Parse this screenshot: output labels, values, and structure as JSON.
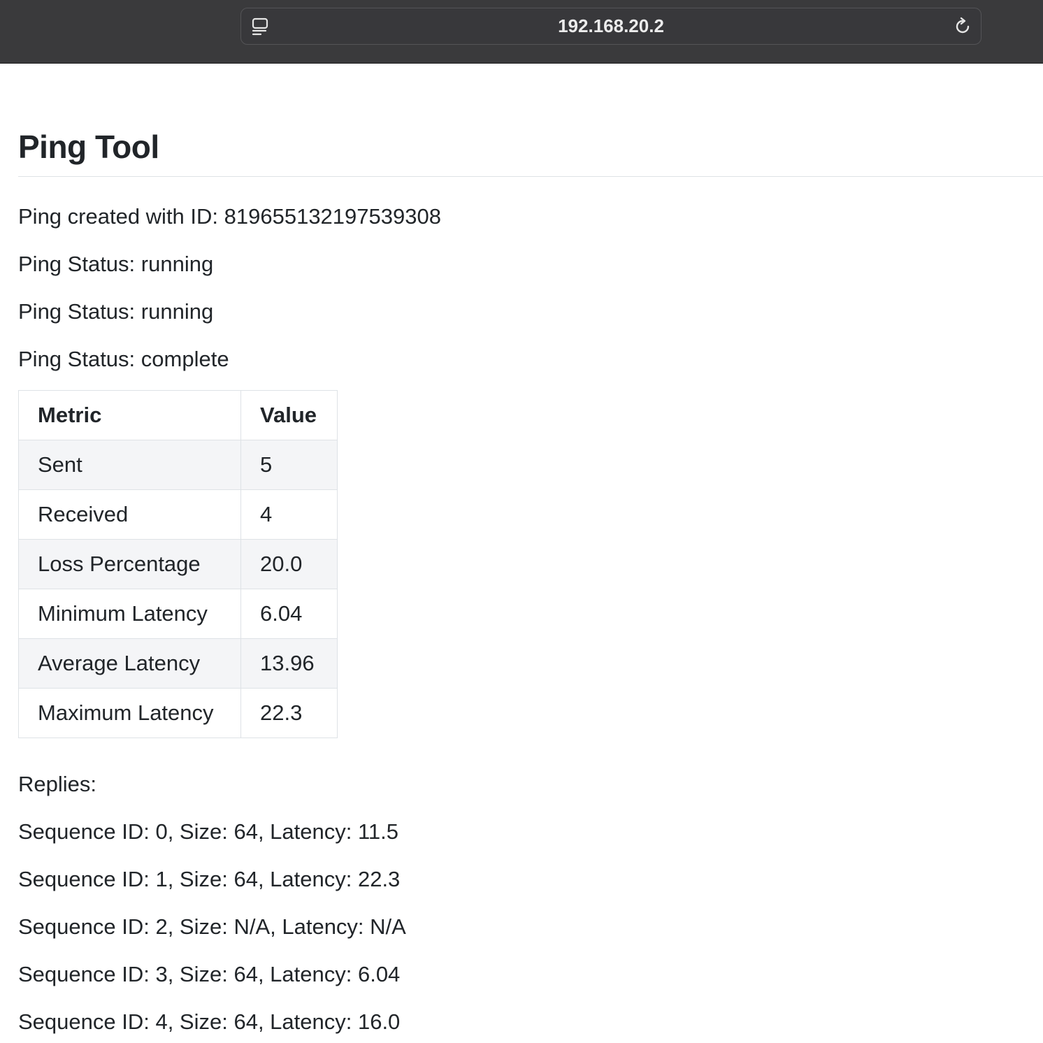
{
  "browser": {
    "url": "192.168.20.2",
    "page_info_icon": "page-info-icon",
    "reload_icon": "reload-icon"
  },
  "page": {
    "title": "Ping Tool",
    "ping_created": "Ping created with ID: 819655132197539308",
    "status_lines": [
      "Ping Status: running",
      "Ping Status: running",
      "Ping Status: complete"
    ],
    "table": {
      "headers": [
        "Metric",
        "Value"
      ],
      "rows": [
        {
          "metric": "Sent",
          "value": "5"
        },
        {
          "metric": "Received",
          "value": "4"
        },
        {
          "metric": "Loss Percentage",
          "value": "20.0"
        },
        {
          "metric": "Minimum Latency",
          "value": "6.04"
        },
        {
          "metric": "Average Latency",
          "value": "13.96"
        },
        {
          "metric": "Maximum Latency",
          "value": "22.3"
        }
      ]
    },
    "replies_label": "Replies:",
    "replies": [
      "Sequence ID: 0, Size: 64, Latency: 11.5",
      "Sequence ID: 1, Size: 64, Latency: 22.3",
      "Sequence ID: 2, Size: N/A, Latency: N/A",
      "Sequence ID: 3, Size: 64, Latency: 6.04",
      "Sequence ID: 4, Size: 64, Latency: 16.0"
    ]
  }
}
